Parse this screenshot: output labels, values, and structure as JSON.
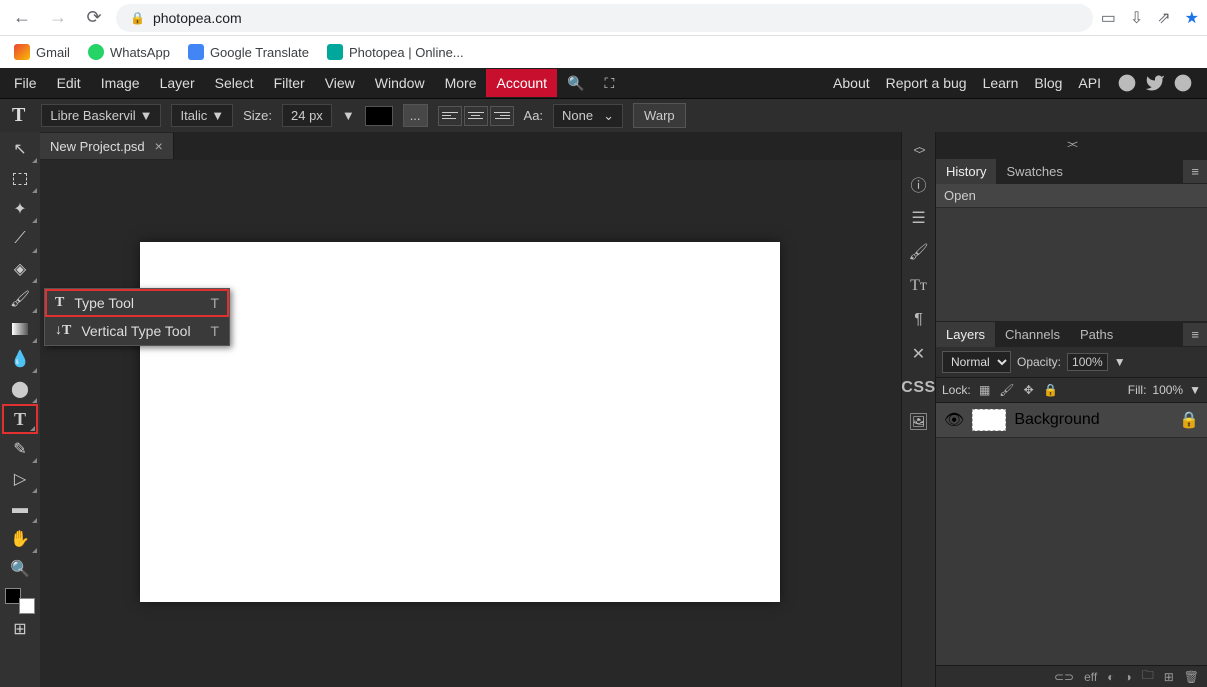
{
  "browser": {
    "url": "photopea.com",
    "bookmarks": [
      {
        "label": "Gmail",
        "color": "#ea4335"
      },
      {
        "label": "WhatsApp",
        "color": "#25d366"
      },
      {
        "label": "Google Translate",
        "color": "#4285f4"
      },
      {
        "label": "Photopea | Online...",
        "color": "#00a89c"
      }
    ]
  },
  "menu": {
    "items": [
      "File",
      "Edit",
      "Image",
      "Layer",
      "Select",
      "Filter",
      "View",
      "Window",
      "More"
    ],
    "account": "Account",
    "right": [
      "About",
      "Report a bug",
      "Learn",
      "Blog",
      "API"
    ]
  },
  "options": {
    "font": "Libre Baskervil",
    "style": "Italic",
    "size_label": "Size:",
    "size": "24 px",
    "aa_label": "Aa:",
    "aa_value": "None",
    "warp": "Warp",
    "dots": "..."
  },
  "document": {
    "tab": "New Project.psd"
  },
  "flyout": {
    "items": [
      {
        "label": "Type Tool",
        "shortcut": "T",
        "selected": true
      },
      {
        "label": "Vertical Type Tool",
        "shortcut": "T",
        "selected": false
      }
    ]
  },
  "panels": {
    "history_tab": "History",
    "swatches_tab": "Swatches",
    "history_item": "Open",
    "layers_tab": "Layers",
    "channels_tab": "Channels",
    "paths_tab": "Paths",
    "blend_mode": "Normal",
    "opacity_label": "Opacity:",
    "opacity_value": "100%",
    "lock_label": "Lock:",
    "fill_label": "Fill:",
    "fill_value": "100%",
    "layer_name": "Background",
    "css": "CSS",
    "footer": {
      "link": "⊂⊃",
      "eff": "eff"
    }
  }
}
